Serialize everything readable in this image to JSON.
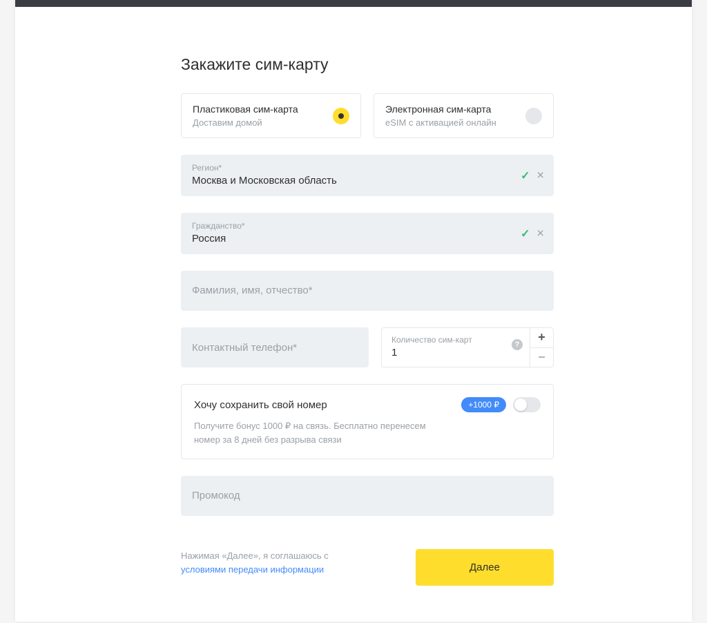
{
  "title": "Закажите сим-карту",
  "simOptions": {
    "plastic": {
      "title": "Пластиковая сим-карта",
      "subtitle": "Доставим домой"
    },
    "esim": {
      "title": "Электронная сим-карта",
      "subtitle": "eSIM с активацией онлайн"
    }
  },
  "region": {
    "label": "Регион*",
    "value": "Москва и Московская область"
  },
  "citizenship": {
    "label": "Гражданство*",
    "value": "Россия"
  },
  "fio": {
    "placeholder": "Фамилия, имя, отчество*"
  },
  "phone": {
    "placeholder": "Контактный телефон*"
  },
  "quantity": {
    "label": "Количество сим-карт",
    "value": "1"
  },
  "keepNumber": {
    "title": "Хочу сохранить свой номер",
    "badge": "+1000 ₽",
    "description": "Получите бонус 1000 ₽ на связь. Бесплатно перенесем номер за 8 дней без разрыва связи"
  },
  "promo": {
    "placeholder": "Промокод"
  },
  "terms": {
    "prefix": "Нажимая «Далее», я соглашаюсь с ",
    "link": "условиями передачи информации"
  },
  "nextButton": "Далее"
}
